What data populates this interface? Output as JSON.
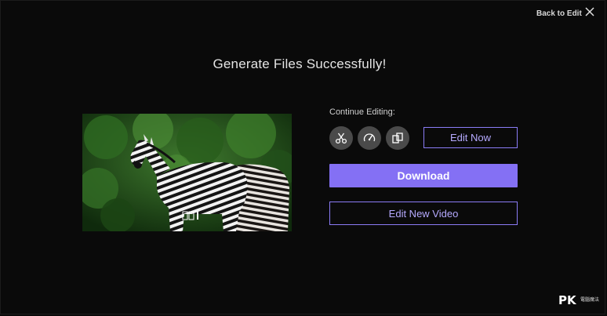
{
  "header": {
    "back_label": "Back to Edit",
    "close_icon": "close-icon"
  },
  "main": {
    "title": "Generate Files Successfully!",
    "continue_label": "Continue Editing:",
    "tools": [
      {
        "icon": "scissors-icon"
      },
      {
        "icon": "speedometer-icon"
      },
      {
        "icon": "crop-icon"
      }
    ],
    "edit_now_label": "Edit Now",
    "download_label": "Download",
    "edit_new_label": "Edit New Video"
  },
  "watermark": {
    "logo_text": "PK",
    "sub_text": "電腦魔法"
  },
  "colors": {
    "accent": "#8470f4",
    "accent_border": "#8b7cf6",
    "background": "#0a0a0a"
  }
}
